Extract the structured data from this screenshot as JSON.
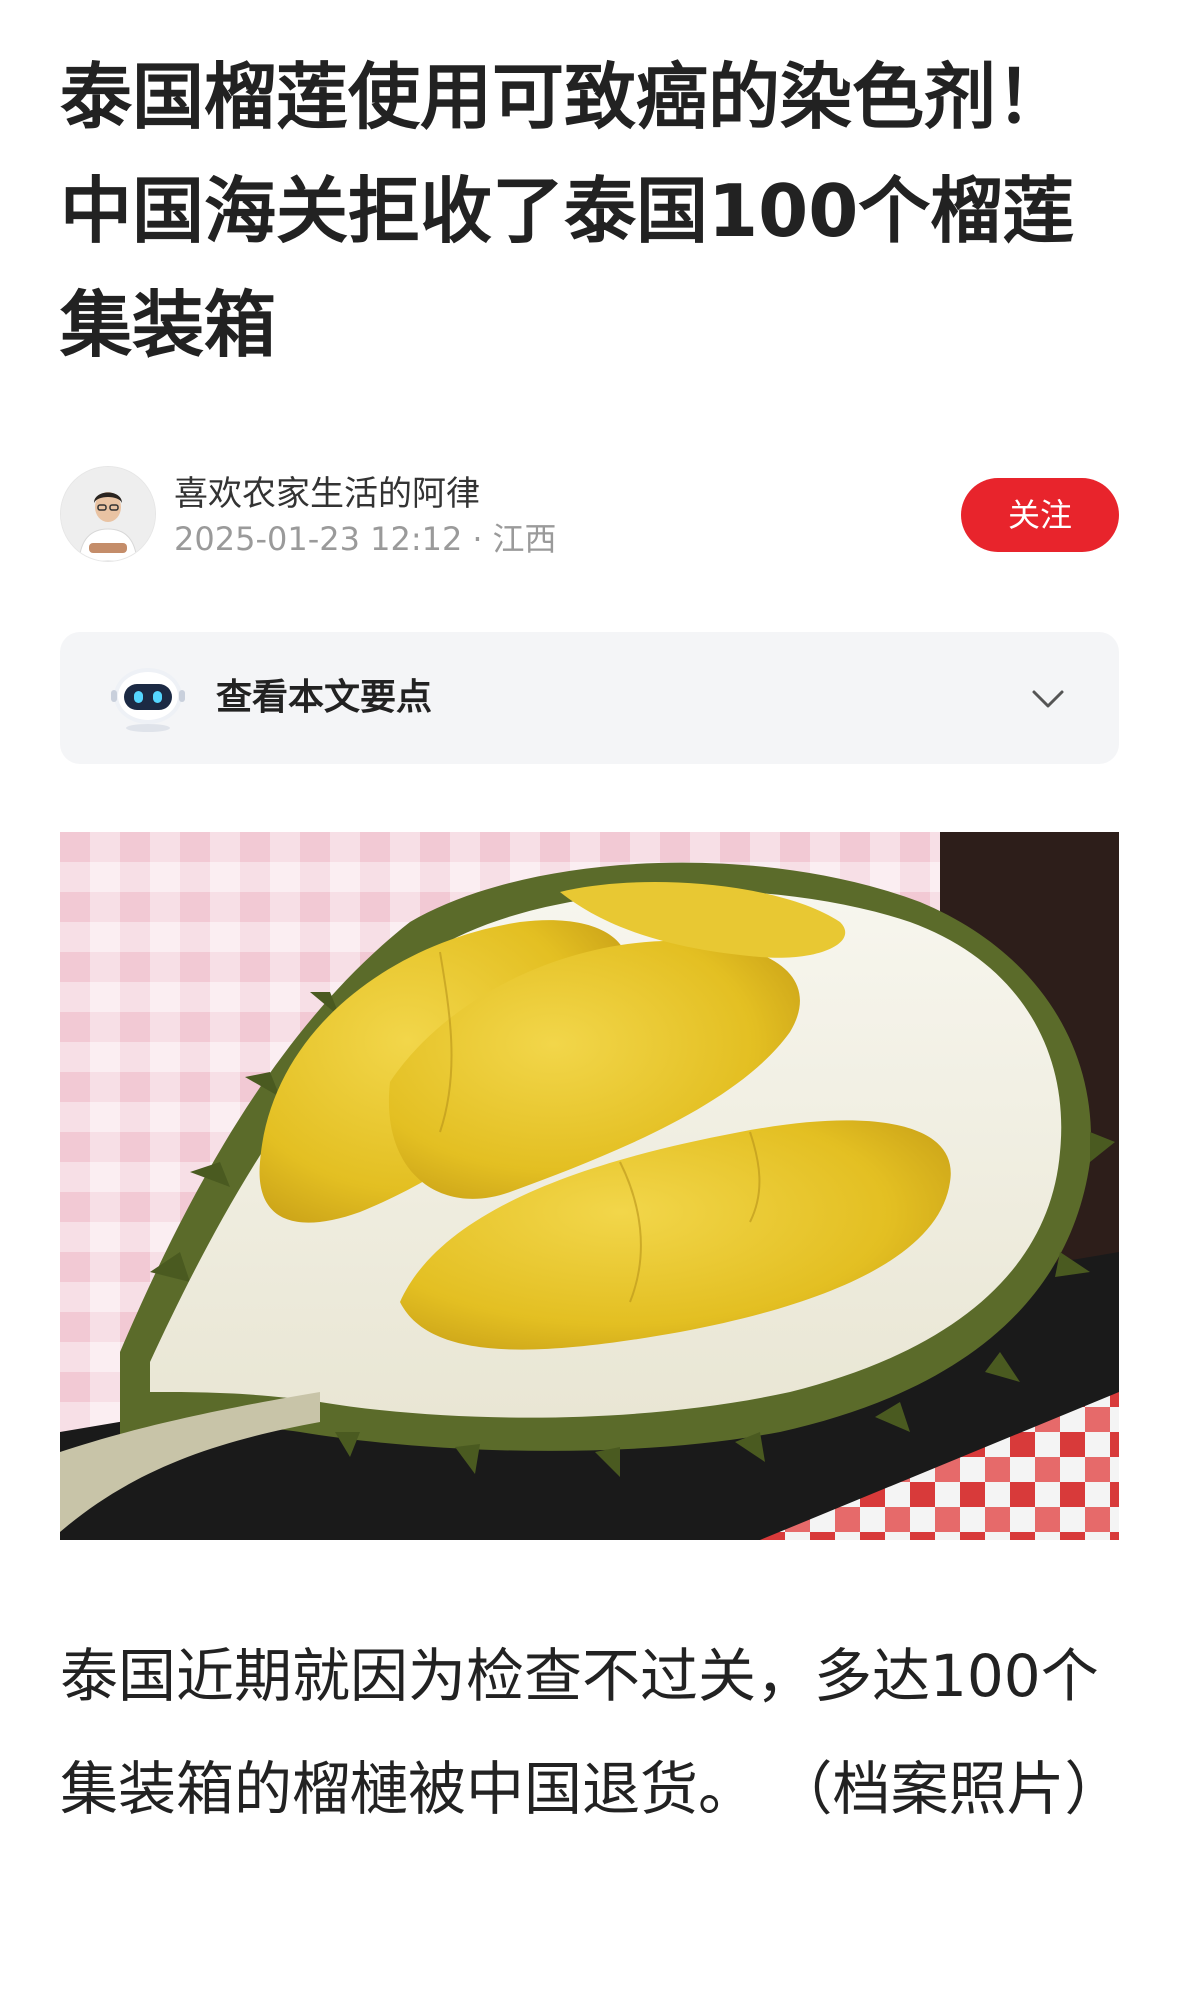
{
  "article": {
    "title": "泰国榴莲使用可致癌的染色剂！中国海关拒收了泰国100个榴莲集装箱"
  },
  "author": {
    "name": "喜欢农家生活的阿律",
    "datetime": "2025-01-23 12:12",
    "separator": "·",
    "location": "江西",
    "follow_label": "关注"
  },
  "summary": {
    "label": "查看本文要点",
    "icon": "robot-icon",
    "toggle_icon": "chevron-down-icon"
  },
  "image": {
    "subject": "durian-photo"
  },
  "body": {
    "paragraph": "泰国近期就因为检查不过关，多达100个集装箱的榴槤被中国退货。 （档案照片）"
  },
  "colors": {
    "accent": "#e8242c",
    "text": "#222222",
    "muted": "#9a9a9a",
    "summary_bg": "#f4f5f7"
  }
}
